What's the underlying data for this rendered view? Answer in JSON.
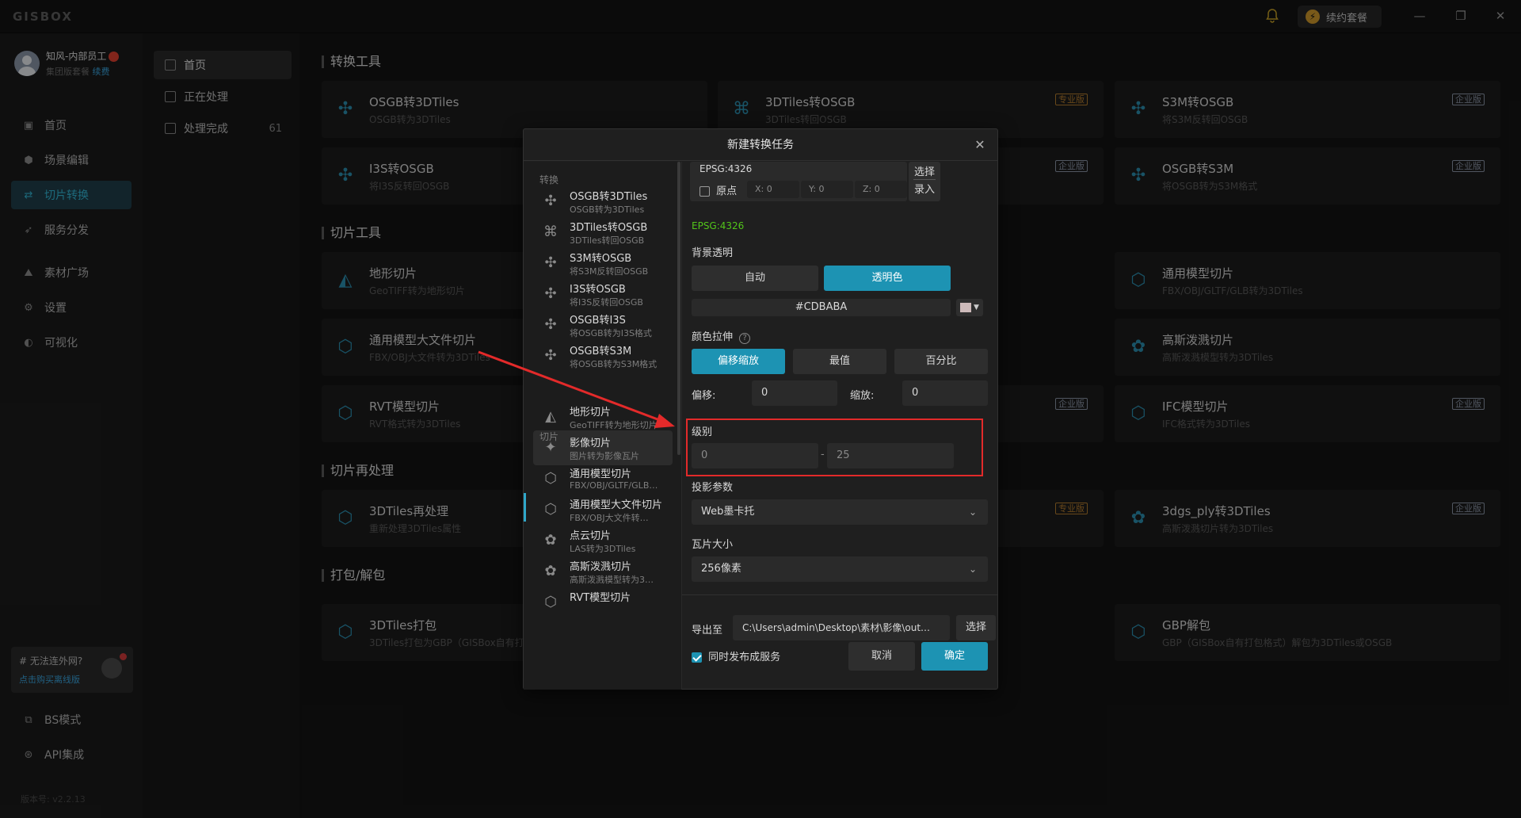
{
  "app": {
    "logo": "GISBOX",
    "renew_label": "续约套餐"
  },
  "window_controls": [
    "—",
    "❐",
    "✕"
  ],
  "user": {
    "name": "知风-内部员工",
    "plan": "集团版套餐",
    "plan_link": "续费"
  },
  "sidebar": {
    "items": [
      {
        "label": "首页",
        "icon": "home-icon"
      },
      {
        "label": "场景编辑",
        "icon": "cube-icon"
      },
      {
        "label": "切片转换",
        "icon": "convert-icon",
        "active": true
      },
      {
        "label": "服务分发",
        "icon": "rocket-icon"
      },
      {
        "label": "素材广场",
        "icon": "chart-icon"
      },
      {
        "label": "设置",
        "icon": "gear-icon"
      },
      {
        "label": "可视化",
        "icon": "globe-icon"
      },
      {
        "label": "BS模式",
        "icon": "code-icon"
      },
      {
        "label": "API集成",
        "icon": "api-icon"
      }
    ],
    "offline": {
      "title": "# 无法连外网?",
      "link": "点击购买离线版"
    },
    "version": "版本号: v2.2.13"
  },
  "subnav": {
    "items": [
      {
        "label": "首页",
        "count": ""
      },
      {
        "label": "正在处理",
        "count": ""
      },
      {
        "label": "处理完成",
        "count": "61"
      }
    ]
  },
  "main": {
    "sections": [
      "转换工具",
      "切片工具",
      "切片再处理",
      "打包/解包"
    ],
    "cards": [
      {
        "title": "OSGB转3DTiles",
        "sub": "OSGB转为3DTiles",
        "tag": ""
      },
      {
        "title": "3DTiles转OSGB",
        "sub": "3DTiles转回OSGB",
        "tag": "专业版"
      },
      {
        "title": "S3M转OSGB",
        "sub": "将S3M反转回OSGB",
        "tag": "企业版"
      },
      {
        "title": "I3S转OSGB",
        "sub": "将I3S反转回OSGB",
        "tag": ""
      },
      {
        "title": "",
        "sub": "",
        "tag": "企业版"
      },
      {
        "title": "OSGB转S3M",
        "sub": "将OSGB转为S3M格式",
        "tag": "企业版"
      },
      {
        "title": "地形切片",
        "sub": "GeoTIFF转为地形切片",
        "tag": ""
      },
      {
        "title": "通用模型切片",
        "sub": "FBX/OBJ/GLTF/GLB转为3DTiles",
        "tag": ""
      },
      {
        "title": "通用模型大文件切片",
        "sub": "FBX/OBJ大文件转为3DTiles",
        "tag": ""
      },
      {
        "title": "高斯泼溅切片",
        "sub": "高斯泼溅模型转为3DTiles",
        "tag": ""
      },
      {
        "title": "RVT模型切片",
        "sub": "RVT格式转为3DTiles",
        "tag": ""
      },
      {
        "title": "",
        "sub": "",
        "tag": "企业版"
      },
      {
        "title": "IFC模型切片",
        "sub": "IFC格式转为3DTiles",
        "tag": "企业版"
      },
      {
        "title": "3DTiles再处理",
        "sub": "重新处理3DTiles属性",
        "tag": ""
      },
      {
        "title": "",
        "sub": "",
        "tag": "专业版"
      },
      {
        "title": "3dgs_ply转3DTiles",
        "sub": "高斯泼溅切片转为3DTiles",
        "tag": "企业版"
      },
      {
        "title": "3DTiles打包",
        "sub": "3DTiles打包为GBP（GISBox自有打",
        "tag": ""
      },
      {
        "title": "GBP解包",
        "sub": "GBP（GISBox自有打包格式）解包为3DTiles或OSGB",
        "tag": ""
      }
    ]
  },
  "modal": {
    "title": "新建转换任务",
    "left": {
      "group1": "转换",
      "group2": "切片",
      "items": [
        {
          "title": "OSGB转3DTiles",
          "sub": "OSGB转为3DTiles"
        },
        {
          "title": "3DTiles转OSGB",
          "sub": "3DTiles转回OSGB"
        },
        {
          "title": "S3M转OSGB",
          "sub": "将S3M反转回OSGB"
        },
        {
          "title": "I3S转OSGB",
          "sub": "将I3S反转回OSGB"
        },
        {
          "title": "OSGB转I3S",
          "sub": "将OSGB转为I3S格式"
        },
        {
          "title": "OSGB转S3M",
          "sub": "将OSGB转为S3M格式"
        },
        {
          "title": "地形切片",
          "sub": "GeoTIFF转为地形切片"
        },
        {
          "title": "影像切片",
          "sub": "图片转为影像瓦片"
        },
        {
          "title": "通用模型切片",
          "sub": "FBX/OBJ/GLTF/GLB…"
        },
        {
          "title": "通用模型大文件切片",
          "sub": "FBX/OBJ大文件转…"
        },
        {
          "title": "点云切片",
          "sub": "LAS转为3DTiles"
        },
        {
          "title": "高斯泼溅切片",
          "sub": "高斯泼溅模型转为3…"
        },
        {
          "title": "RVT模型切片",
          "sub": ""
        }
      ]
    },
    "epsg_top": "EPSG:4326",
    "origin_label": "原点",
    "x_label": "X: 0",
    "y_label": "Y: 0",
    "z_label": "Z: 0",
    "select_label": "选择",
    "input_label": "录入",
    "epsg_green": "EPSG:4326",
    "bg_transparent": "背景透明",
    "auto_btn": "自动",
    "transparent_btn": "透明色",
    "color_value": "#CDBABA",
    "swatch_color": "#CDBABA",
    "stretch": "颜色拉伸",
    "stretch_btns": [
      "偏移缩放",
      "最值",
      "百分比"
    ],
    "offset_label": "偏移:",
    "offset_value": "0",
    "scale_label": "缩放:",
    "scale_value": "0",
    "level_label": "级别",
    "level_min": "0",
    "level_sep": "-",
    "level_max": "25",
    "proj_label": "投影参数",
    "proj_value": "Web墨卡托",
    "tile_label": "瓦片大小",
    "tile_value": "256像素",
    "export_label": "导出至",
    "export_path": "C:\\Users\\admin\\Desktop\\素材\\影像\\out…",
    "export_select": "选择",
    "publish_label": "同时发布成服务",
    "cancel": "取消",
    "confirm": "确定"
  }
}
